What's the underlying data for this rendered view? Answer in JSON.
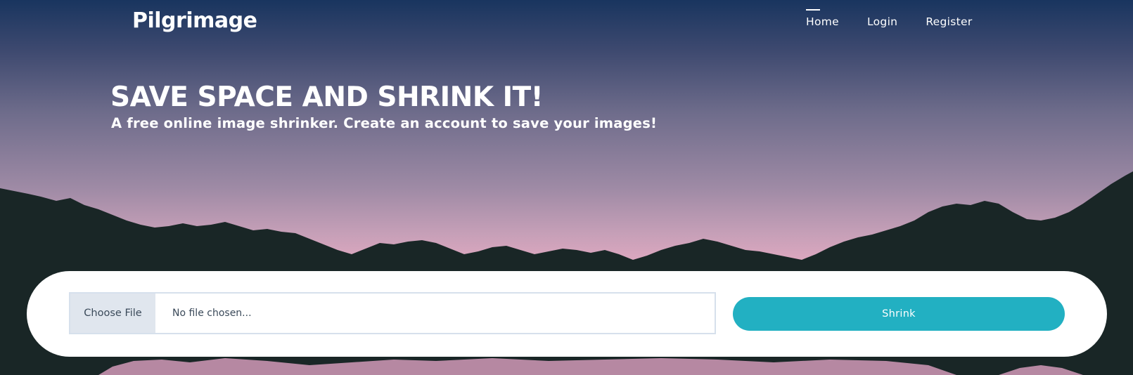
{
  "header": {
    "brand": "Pilgrimage",
    "nav": [
      {
        "label": "Home",
        "active": true
      },
      {
        "label": "Login",
        "active": false
      },
      {
        "label": "Register",
        "active": false
      }
    ]
  },
  "hero": {
    "title": "SAVE SPACE AND SHRINK IT!",
    "subtitle": "A free online image shrinker. Create an account to save your images!"
  },
  "upload": {
    "choose_file_label": "Choose File",
    "file_status": "No file chosen...",
    "submit_label": "Shrink"
  },
  "colors": {
    "accent": "#22b0c2",
    "mountains": "#192626",
    "sky_top": "#19355f",
    "sky_bottom": "#dea8c0"
  }
}
